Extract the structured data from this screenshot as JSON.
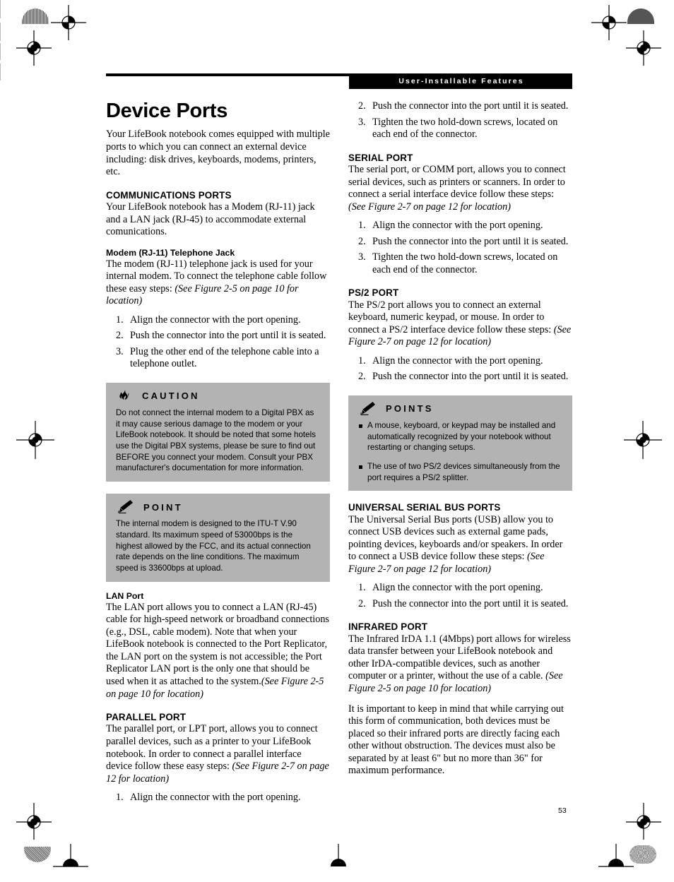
{
  "header": {
    "running_head": "User-Installable Features"
  },
  "page_number": "53",
  "title": "Device Ports",
  "intro": "Your LifeBook notebook comes equipped with multiple ports to which you can connect an external device including: disk drives, keyboards, modems, printers, etc.",
  "left_column": {
    "communications": {
      "heading": "COMMUNICATIONS PORTS",
      "body": "Your LifeBook notebook has a Modem (RJ-11) jack and a LAN jack (RJ-45) to accommodate external comunications."
    },
    "modem_jack": {
      "heading": "Modem (RJ-11) Telephone Jack",
      "body_plain": "The modem (RJ-11) telephone jack is used for your internal modem. To connect the telephone cable follow these easy steps: ",
      "body_italic": "(See Figure 2-5 on page 10 for location)",
      "steps": [
        "Align the connector with the port opening.",
        "Push the connector into the port until it is seated.",
        "Plug the other end of the telephone cable into a telephone outlet."
      ]
    },
    "caution_box": {
      "label": "CAUTION",
      "icon": "flame-icon",
      "text": "Do not connect the internal modem to a Digital PBX as it may cause serious damage to the modem or your LifeBook notebook. It should be noted that some hotels use the Digital PBX systems, please be sure to find out BEFORE you connect your modem. Consult your PBX manufacturer's documentation for more information."
    },
    "point_box": {
      "label": "POINT",
      "icon": "pencil-icon",
      "text": "The internal modem is designed to the ITU-T V.90 standard. Its maximum speed of 53000bps is the highest allowed by the FCC, and its actual connection rate depends on the line conditions. The maximum speed is 33600bps at upload."
    },
    "lan_port": {
      "heading": "LAN Port",
      "body_plain": "The LAN port allows you to connect a LAN (RJ-45) cable for high-speed network or broadband connections (e.g., DSL, cable modem). Note that when your LifeBook notebook is connected to the Port Replicator, the LAN port on the system is not accessible; the Port Replicator LAN port is the only one that should be used when it as attached to the system.",
      "body_italic": "(See Figure 2-5 on page 10 for location)"
    },
    "parallel_port": {
      "heading": "PARALLEL PORT",
      "body_plain": "The parallel port, or LPT port, allows you to connect parallel devices, such as a printer to your LifeBook notebook. In order to connect a parallel interface device follow these easy steps: ",
      "body_italic": "(See Figure 2-7 on page 12 for location)",
      "steps": [
        "Align the connector with the port opening."
      ]
    }
  },
  "right_column": {
    "parallel_steps_continued": [
      "Push the connector into the port until it is seated.",
      "Tighten the two hold-down screws, located on each end of the connector."
    ],
    "serial_port": {
      "heading": "SERIAL PORT",
      "body_plain": "The serial port, or COMM port, allows you to connect serial devices, such as printers or scanners. In order to connect a serial interface device follow these steps: ",
      "body_italic": "(See Figure 2-7 on page 12 for location)",
      "steps": [
        "Align the connector with the port opening.",
        "Push the connector into the port until it is seated.",
        "Tighten the two hold-down screws, located on each end of the connector."
      ]
    },
    "ps2_port": {
      "heading": "PS/2 PORT",
      "body_plain": "The PS/2 port allows you to connect an external keyboard, numeric keypad, or mouse. In order to connect a PS/2 interface device follow these steps: ",
      "body_italic": "(See Figure 2-7 on page 12 for location)",
      "steps": [
        "Align the connector with the port opening.",
        "Push the connector into the port until it is seated."
      ]
    },
    "points_box": {
      "label": "POINTS",
      "icon": "pencil-icon",
      "items": [
        "A mouse, keyboard, or keypad may be installed and automatically recognized by your notebook without restarting or changing setups.",
        "The use of two PS/2 devices simultaneously from the port requires a PS/2 splitter."
      ]
    },
    "usb_ports": {
      "heading": "UNIVERSAL SERIAL BUS PORTS",
      "body_plain": "The Universal Serial Bus ports (USB) allow you to connect USB devices such as external game pads, pointing devices, keyboards and/or speakers. In order to connect a USB device follow these steps: ",
      "body_italic": "(See Figure 2-7 on page 12 for location)",
      "steps": [
        "Align the connector with the port opening.",
        "Push the connector into the port until it is seated."
      ]
    },
    "infrared_port": {
      "heading": "INFRARED PORT",
      "body_plain": "The Infrared IrDA 1.1 (4Mbps) port allows for wireless data transfer between your LifeBook notebook and other IrDA-compatible devices, such as another computer or a printer, without the use of a cable. ",
      "body_italic": "(See Figure 2-5 on page 10 for location)",
      "body2": "It is important to keep in mind that while carrying out this form of communication, both devices must be placed so their infrared ports are directly facing each other without obstruction. The devices must also be separated by at least 6\" but no more than 36\" for maximum performance."
    }
  },
  "colors": {
    "callout_bg": "#b3b3b3",
    "header_bar": "#000000",
    "text": "#000000"
  }
}
